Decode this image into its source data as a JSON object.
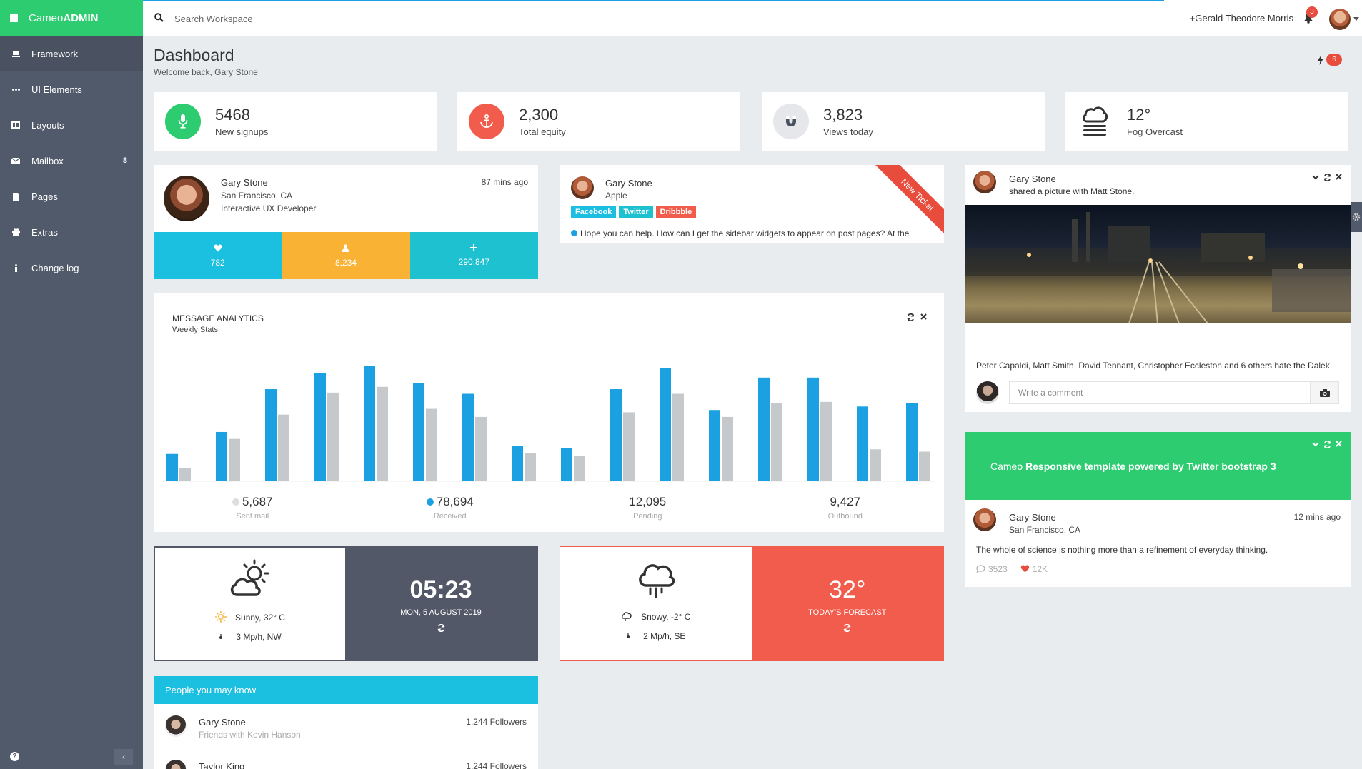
{
  "brand": {
    "prefix": "Cameo",
    "suffix": "ADMIN"
  },
  "sidebar": {
    "items": [
      {
        "label": "Framework",
        "icon": "laptop-icon"
      },
      {
        "label": "UI Elements",
        "icon": "ellipsis-icon"
      },
      {
        "label": "Layouts",
        "icon": "columns-icon"
      },
      {
        "label": "Mailbox",
        "icon": "envelope-icon",
        "badge": "8"
      },
      {
        "label": "Pages",
        "icon": "file-icon"
      },
      {
        "label": "Extras",
        "icon": "gift-icon"
      },
      {
        "label": "Change log",
        "icon": "info-icon"
      }
    ],
    "help": "?",
    "collapse": "‹"
  },
  "topbar": {
    "search_placeholder": "Search Workspace",
    "user": "+Gerald Theodore Morris",
    "notifications": "3"
  },
  "header": {
    "title": "Dashboard",
    "subtitle": "Welcome back, Gary Stone",
    "flash_count": "6"
  },
  "stats": [
    {
      "value": "5468",
      "label": "New signups",
      "color": "#2ecc71",
      "icon": "microphone-icon"
    },
    {
      "value": "2,300",
      "label": "Total equity",
      "color": "#f25c4c",
      "icon": "anchor-icon"
    },
    {
      "value": "3,823",
      "label": "Views today",
      "color": "#e5e7ea",
      "icon": "magnet-icon"
    },
    {
      "value": "12°",
      "label": "Fog Overcast",
      "color": "#ffffff",
      "icon": "fog-icon"
    }
  ],
  "profile": {
    "name": "Gary Stone",
    "location": "San Francisco, CA",
    "role": "Interactive UX Developer",
    "time": "87 mins ago",
    "stats": [
      {
        "value": "782",
        "icon": "heart-icon",
        "color": "#1bbfe0"
      },
      {
        "value": "8,234",
        "icon": "user-icon",
        "color": "#f9b234"
      },
      {
        "value": "290,847",
        "icon": "plus-icon",
        "color": "#1ec1cf"
      }
    ]
  },
  "ticket": {
    "name": "Gary Stone",
    "company": "Apple",
    "tags": [
      {
        "label": "Facebook",
        "color": "#1bbfe0"
      },
      {
        "label": "Twitter",
        "color": "#1ec1cf"
      },
      {
        "label": "Dribbble",
        "color": "#f25c4c"
      }
    ],
    "message": "Hope you can help. How can I get the sidebar widgets to appear on post pages? At the moment they only appear on the homepage.",
    "ribbon": "New Ticket"
  },
  "analytics": {
    "title": "MESSAGE ANALYTICS",
    "subtitle": "Weekly Stats",
    "summary": [
      {
        "value": "5,687",
        "label": "Sent mail",
        "dot": "#dddddd"
      },
      {
        "value": "78,694",
        "label": "Received",
        "dot": "#1ba1e2"
      },
      {
        "value": "12,095",
        "label": "Pending",
        "dot": ""
      },
      {
        "value": "9,427",
        "label": "Outbound",
        "dot": ""
      }
    ]
  },
  "chart_data": {
    "type": "bar",
    "grid": false,
    "legend": "none",
    "ylim": [
      0,
      100
    ],
    "series": [
      {
        "color": "#1ba1e2",
        "values": [
          23,
          42,
          79,
          93,
          99,
          84,
          75,
          30,
          28,
          79,
          97,
          61,
          89,
          89,
          64,
          67
        ]
      },
      {
        "color": "#c5c9cc",
        "values": [
          11,
          36,
          57,
          76,
          81,
          62,
          55,
          24,
          21,
          59,
          75,
          55,
          67,
          68,
          27,
          25
        ]
      }
    ]
  },
  "weather1": {
    "condition": "Sunny, 32° C",
    "wind": "3 Mp/h, NW",
    "time": "05:23",
    "date": "MON, 5 AUGUST 2019",
    "panel_color": "#525868"
  },
  "weather2": {
    "condition": "Snowy, -2° C",
    "wind": "2 Mp/h, SE",
    "temp": "32°",
    "label": "TODAY'S FORECAST",
    "panel_color": "#f25c4c"
  },
  "people": {
    "title": "People you may know",
    "items": [
      {
        "name": "Gary Stone",
        "sub": "Friends with Kevin Hanson",
        "followers": "1,244 Followers"
      },
      {
        "name": "Taylor King",
        "sub": "",
        "followers": "1,244 Followers"
      }
    ]
  },
  "photo_post": {
    "name": "Gary Stone",
    "action": "shared a picture with Matt Stone.",
    "caption": "Peter Capaldi, Matt Smith, David Tennant, Christopher Eccleston and 6 others hate the Dalek.",
    "comment_placeholder": "Write a comment"
  },
  "promo": {
    "prefix": "Cameo ",
    "bold": "Responsive template powered by Twitter bootstrap 3"
  },
  "quote_post": {
    "name": "Gary Stone",
    "location": "San Francisco, CA",
    "time": "12 mins ago",
    "quote": "The whole of science is nothing more than a refinement of everyday thinking.",
    "comments": "3523",
    "likes": "12K"
  }
}
